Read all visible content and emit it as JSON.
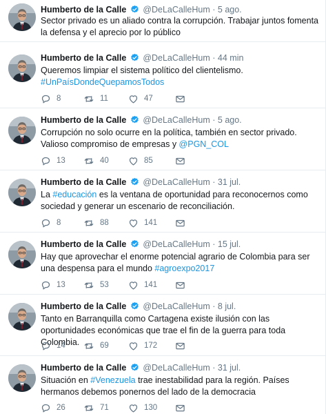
{
  "tweets": [
    {
      "name": "Humberto de la Calle",
      "handle": "@DeLaCalleHum",
      "time": "5 ago.",
      "text": "Sector privado es un aliado contra la corrupción. Trabajar juntos fomenta la defensa y el aprecio por lo público",
      "reply_count": "",
      "retweet_count": "",
      "like_count": ""
    },
    {
      "name": "Humberto de la Calle",
      "handle": "@DeLaCalleHum",
      "time": "44 min",
      "text_pre": "Queremos limpiar el sistema político del clientelismo.",
      "hashtag": "#UnPaísDondeQuepamosTodos",
      "reply_count": "8",
      "retweet_count": "11",
      "like_count": "47"
    },
    {
      "name": "Humberto de la Calle",
      "handle": "@DeLaCalleHum",
      "time": "5 ago.",
      "text_pre": "Corrupción no solo ocurre en la política, también en sector privado. Valioso compromiso de empresas y ",
      "mention": "@PGN_COL",
      "reply_count": "13",
      "retweet_count": "40",
      "like_count": "85"
    },
    {
      "name": "Humberto de la Calle",
      "handle": "@DeLaCalleHum",
      "time": "31 jul.",
      "text_pre": "La ",
      "hashtag": "#educación",
      "text_post": " es la ventana de oportunidad para reconocernos como sociedad y generar un escenario de reconciliación.",
      "reply_count": "8",
      "retweet_count": "88",
      "like_count": "141"
    },
    {
      "name": "Humberto de la Calle",
      "handle": "@DeLaCalleHum",
      "time": "15 jul.",
      "text_pre": "Hay que aprovechar el enorme potencial agrario de Colombia para ser una despensa para el mundo ",
      "hashtag": "#agroexpo2017",
      "reply_count": "13",
      "retweet_count": "53",
      "like_count": "141"
    },
    {
      "name": "Humberto de la Calle",
      "handle": "@DeLaCalleHum",
      "time": "8 jul.",
      "text": "Tanto en Barranquilla como Cartagena existe ilusión con las oportunidades económicas que trae el fin de la guerra para toda Colombia.",
      "reply_count": "14",
      "retweet_count": "69",
      "like_count": "172"
    },
    {
      "name": "Humberto de la Calle",
      "handle": "@DeLaCalleHum",
      "time": "31 jul.",
      "text_pre": "Situación en ",
      "hashtag": "#Venezuela",
      "text_post": " trae inestabilidad para la región. Países hermanos debemos ponernos del lado de la democracia",
      "reply_count": "26",
      "retweet_count": "71",
      "like_count": "130"
    }
  ],
  "separator": "·",
  "colors": {
    "link": "#1b95e0",
    "muted": "#657786",
    "text": "#14171a",
    "verified": "#1da1f2",
    "border": "#e6ecf0"
  },
  "icons": [
    "verified-badge-icon",
    "reply-icon",
    "retweet-icon",
    "like-icon",
    "direct-message-icon"
  ]
}
